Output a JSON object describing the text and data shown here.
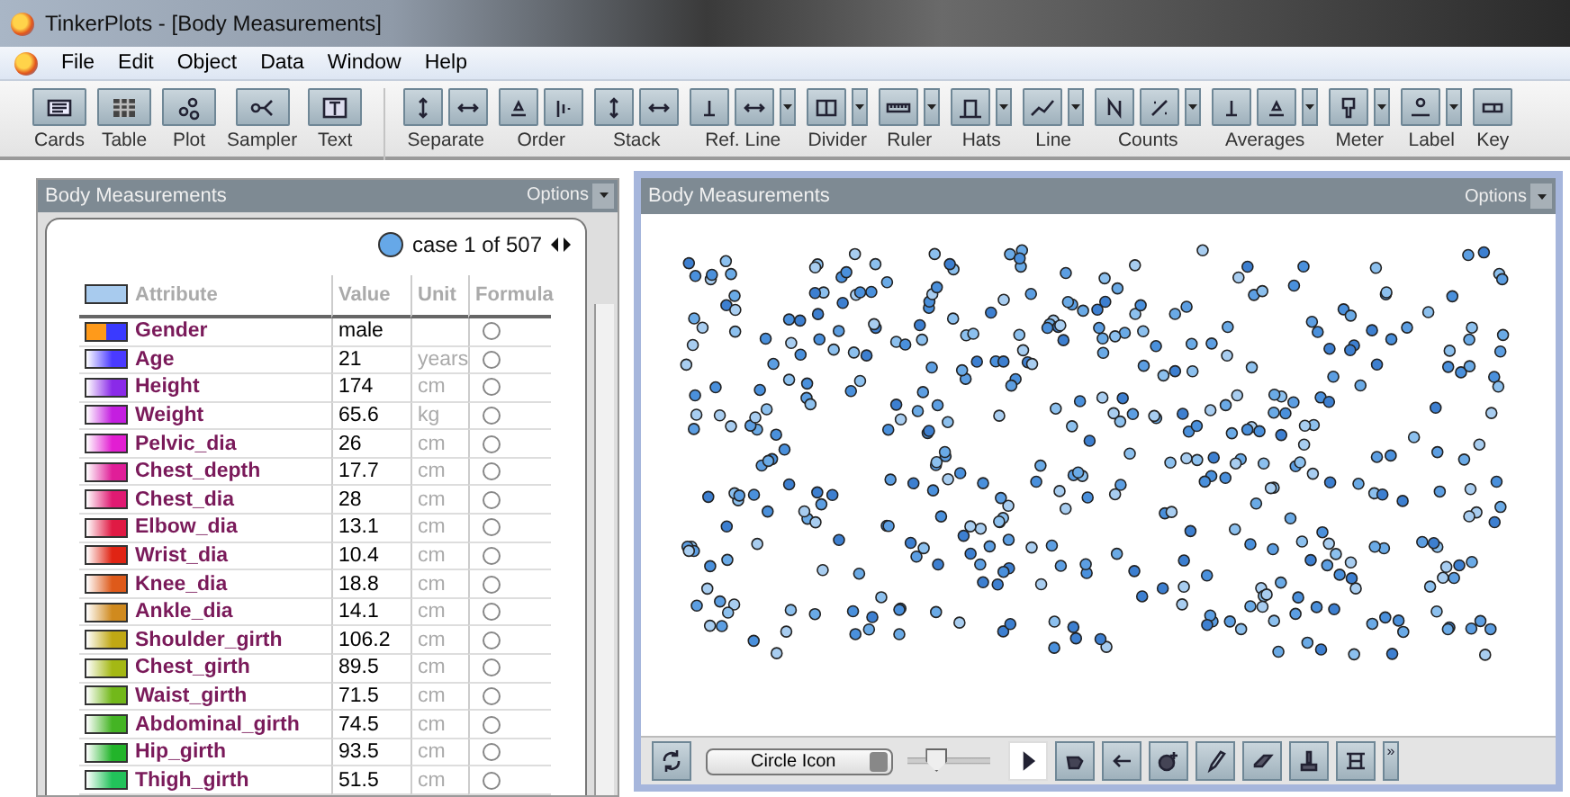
{
  "window": {
    "title": "TinkerPlots - [Body Measurements]"
  },
  "menu": [
    "File",
    "Edit",
    "Object",
    "Data",
    "Window",
    "Help"
  ],
  "toolbar_objects": [
    {
      "label": "Cards"
    },
    {
      "label": "Table"
    },
    {
      "label": "Plot"
    },
    {
      "label": "Sampler"
    },
    {
      "label": "Text"
    }
  ],
  "toolbar_groups": [
    {
      "label": "Separate",
      "buttons": [
        {
          "kind": "vertical"
        },
        {
          "kind": "horizontal"
        }
      ]
    },
    {
      "label": "Order",
      "buttons": [
        {
          "kind": "triangle"
        },
        {
          "kind": "bars"
        }
      ]
    },
    {
      "label": "Stack",
      "buttons": [
        {
          "kind": "vertical"
        },
        {
          "kind": "horizontal"
        }
      ]
    },
    {
      "label": "Ref. Line",
      "buttons": [
        {
          "kind": "tee"
        },
        {
          "kind": "horizontal"
        }
      ],
      "menu": true
    },
    {
      "label": "Divider",
      "buttons": [
        {
          "kind": "columns"
        }
      ],
      "menu": true
    },
    {
      "label": "Ruler",
      "buttons": [
        {
          "kind": "ruler"
        }
      ],
      "menu": true
    },
    {
      "label": "Hats",
      "buttons": [
        {
          "kind": "hat"
        }
      ],
      "menu": true
    },
    {
      "label": "Line",
      "buttons": [
        {
          "kind": "zigzag"
        }
      ],
      "menu": true
    },
    {
      "label": "Counts",
      "buttons": [
        {
          "kind": "letter"
        },
        {
          "kind": "percent"
        }
      ],
      "menu": true
    },
    {
      "label": "Averages",
      "buttons": [
        {
          "kind": "tee"
        },
        {
          "kind": "triangle"
        }
      ],
      "menu": true
    },
    {
      "label": "Meter",
      "buttons": [
        {
          "kind": "meter"
        }
      ],
      "menu": true
    },
    {
      "label": "Label",
      "buttons": [
        {
          "kind": "label"
        }
      ],
      "menu": true
    },
    {
      "label": "Key",
      "buttons": [
        {
          "kind": "key"
        }
      ]
    }
  ],
  "case_table": {
    "title": "Body Measurements",
    "options": "Options",
    "case_label": "case 1 of 507",
    "columns": [
      "Attribute",
      "Value",
      "Unit",
      "Formula"
    ],
    "rows": [
      {
        "name": "Gender",
        "value": "male",
        "kind": "categorical",
        "swatch": [
          {
            "color": "#ff9a1a"
          },
          {
            "color": "#3a3aff"
          }
        ]
      },
      {
        "name": "Age",
        "value": "21",
        "unit": "years",
        "kind": "numeric",
        "color": "#4a3aff"
      },
      {
        "name": "Height",
        "value": "174",
        "unit": "cm",
        "kind": "numeric",
        "color": "#8a2ae8"
      },
      {
        "name": "Weight",
        "value": "65.6",
        "unit": "kg",
        "kind": "numeric",
        "color": "#c41ee0"
      },
      {
        "name": "Pelvic_dia",
        "value": "26",
        "unit": "cm",
        "kind": "numeric",
        "color": "#e21ed2"
      },
      {
        "name": "Chest_depth",
        "value": "17.7",
        "unit": "cm",
        "kind": "numeric",
        "color": "#e01e98"
      },
      {
        "name": "Chest_dia",
        "value": "28",
        "unit": "cm",
        "kind": "numeric",
        "color": "#e01a72"
      },
      {
        "name": "Elbow_dia",
        "value": "13.1",
        "unit": "cm",
        "kind": "numeric",
        "color": "#e01a44"
      },
      {
        "name": "Wrist_dia",
        "value": "10.4",
        "unit": "cm",
        "kind": "numeric",
        "color": "#e02414"
      },
      {
        "name": "Knee_dia",
        "value": "18.8",
        "unit": "cm",
        "kind": "numeric",
        "color": "#de5a1a"
      },
      {
        "name": "Ankle_dia",
        "value": "14.1",
        "unit": "cm",
        "kind": "numeric",
        "color": "#d08a1e"
      },
      {
        "name": "Shoulder_girth",
        "value": "106.2",
        "unit": "cm",
        "kind": "numeric",
        "color": "#c0a814"
      },
      {
        "name": "Chest_girth",
        "value": "89.5",
        "unit": "cm",
        "kind": "numeric",
        "color": "#a4b814"
      },
      {
        "name": "Waist_girth",
        "value": "71.5",
        "unit": "cm",
        "kind": "numeric",
        "color": "#72b81a"
      },
      {
        "name": "Abdominal_girth",
        "value": "74.5",
        "unit": "cm",
        "kind": "numeric",
        "color": "#44b424"
      },
      {
        "name": "Hip_girth",
        "value": "93.5",
        "unit": "cm",
        "kind": "numeric",
        "color": "#22b42a"
      },
      {
        "name": "Thigh_girth",
        "value": "51.5",
        "unit": "cm",
        "kind": "numeric",
        "color": "#22c25a"
      }
    ]
  },
  "plot": {
    "title": "Body Measurements",
    "options": "Options",
    "icon_menu": "Circle Icon",
    "icon_size": {
      "level": 0.3
    },
    "tools": [
      {
        "kind": "pointer",
        "selected": true
      },
      {
        "kind": "drag",
        "selected": false
      },
      {
        "kind": "back",
        "selected": false
      },
      {
        "kind": "add",
        "selected": false
      },
      {
        "kind": "pencil",
        "selected": false
      },
      {
        "kind": "eraser",
        "selected": false
      },
      {
        "kind": "brush",
        "selected": false
      },
      {
        "kind": "text",
        "selected": false
      }
    ],
    "more": "»"
  }
}
